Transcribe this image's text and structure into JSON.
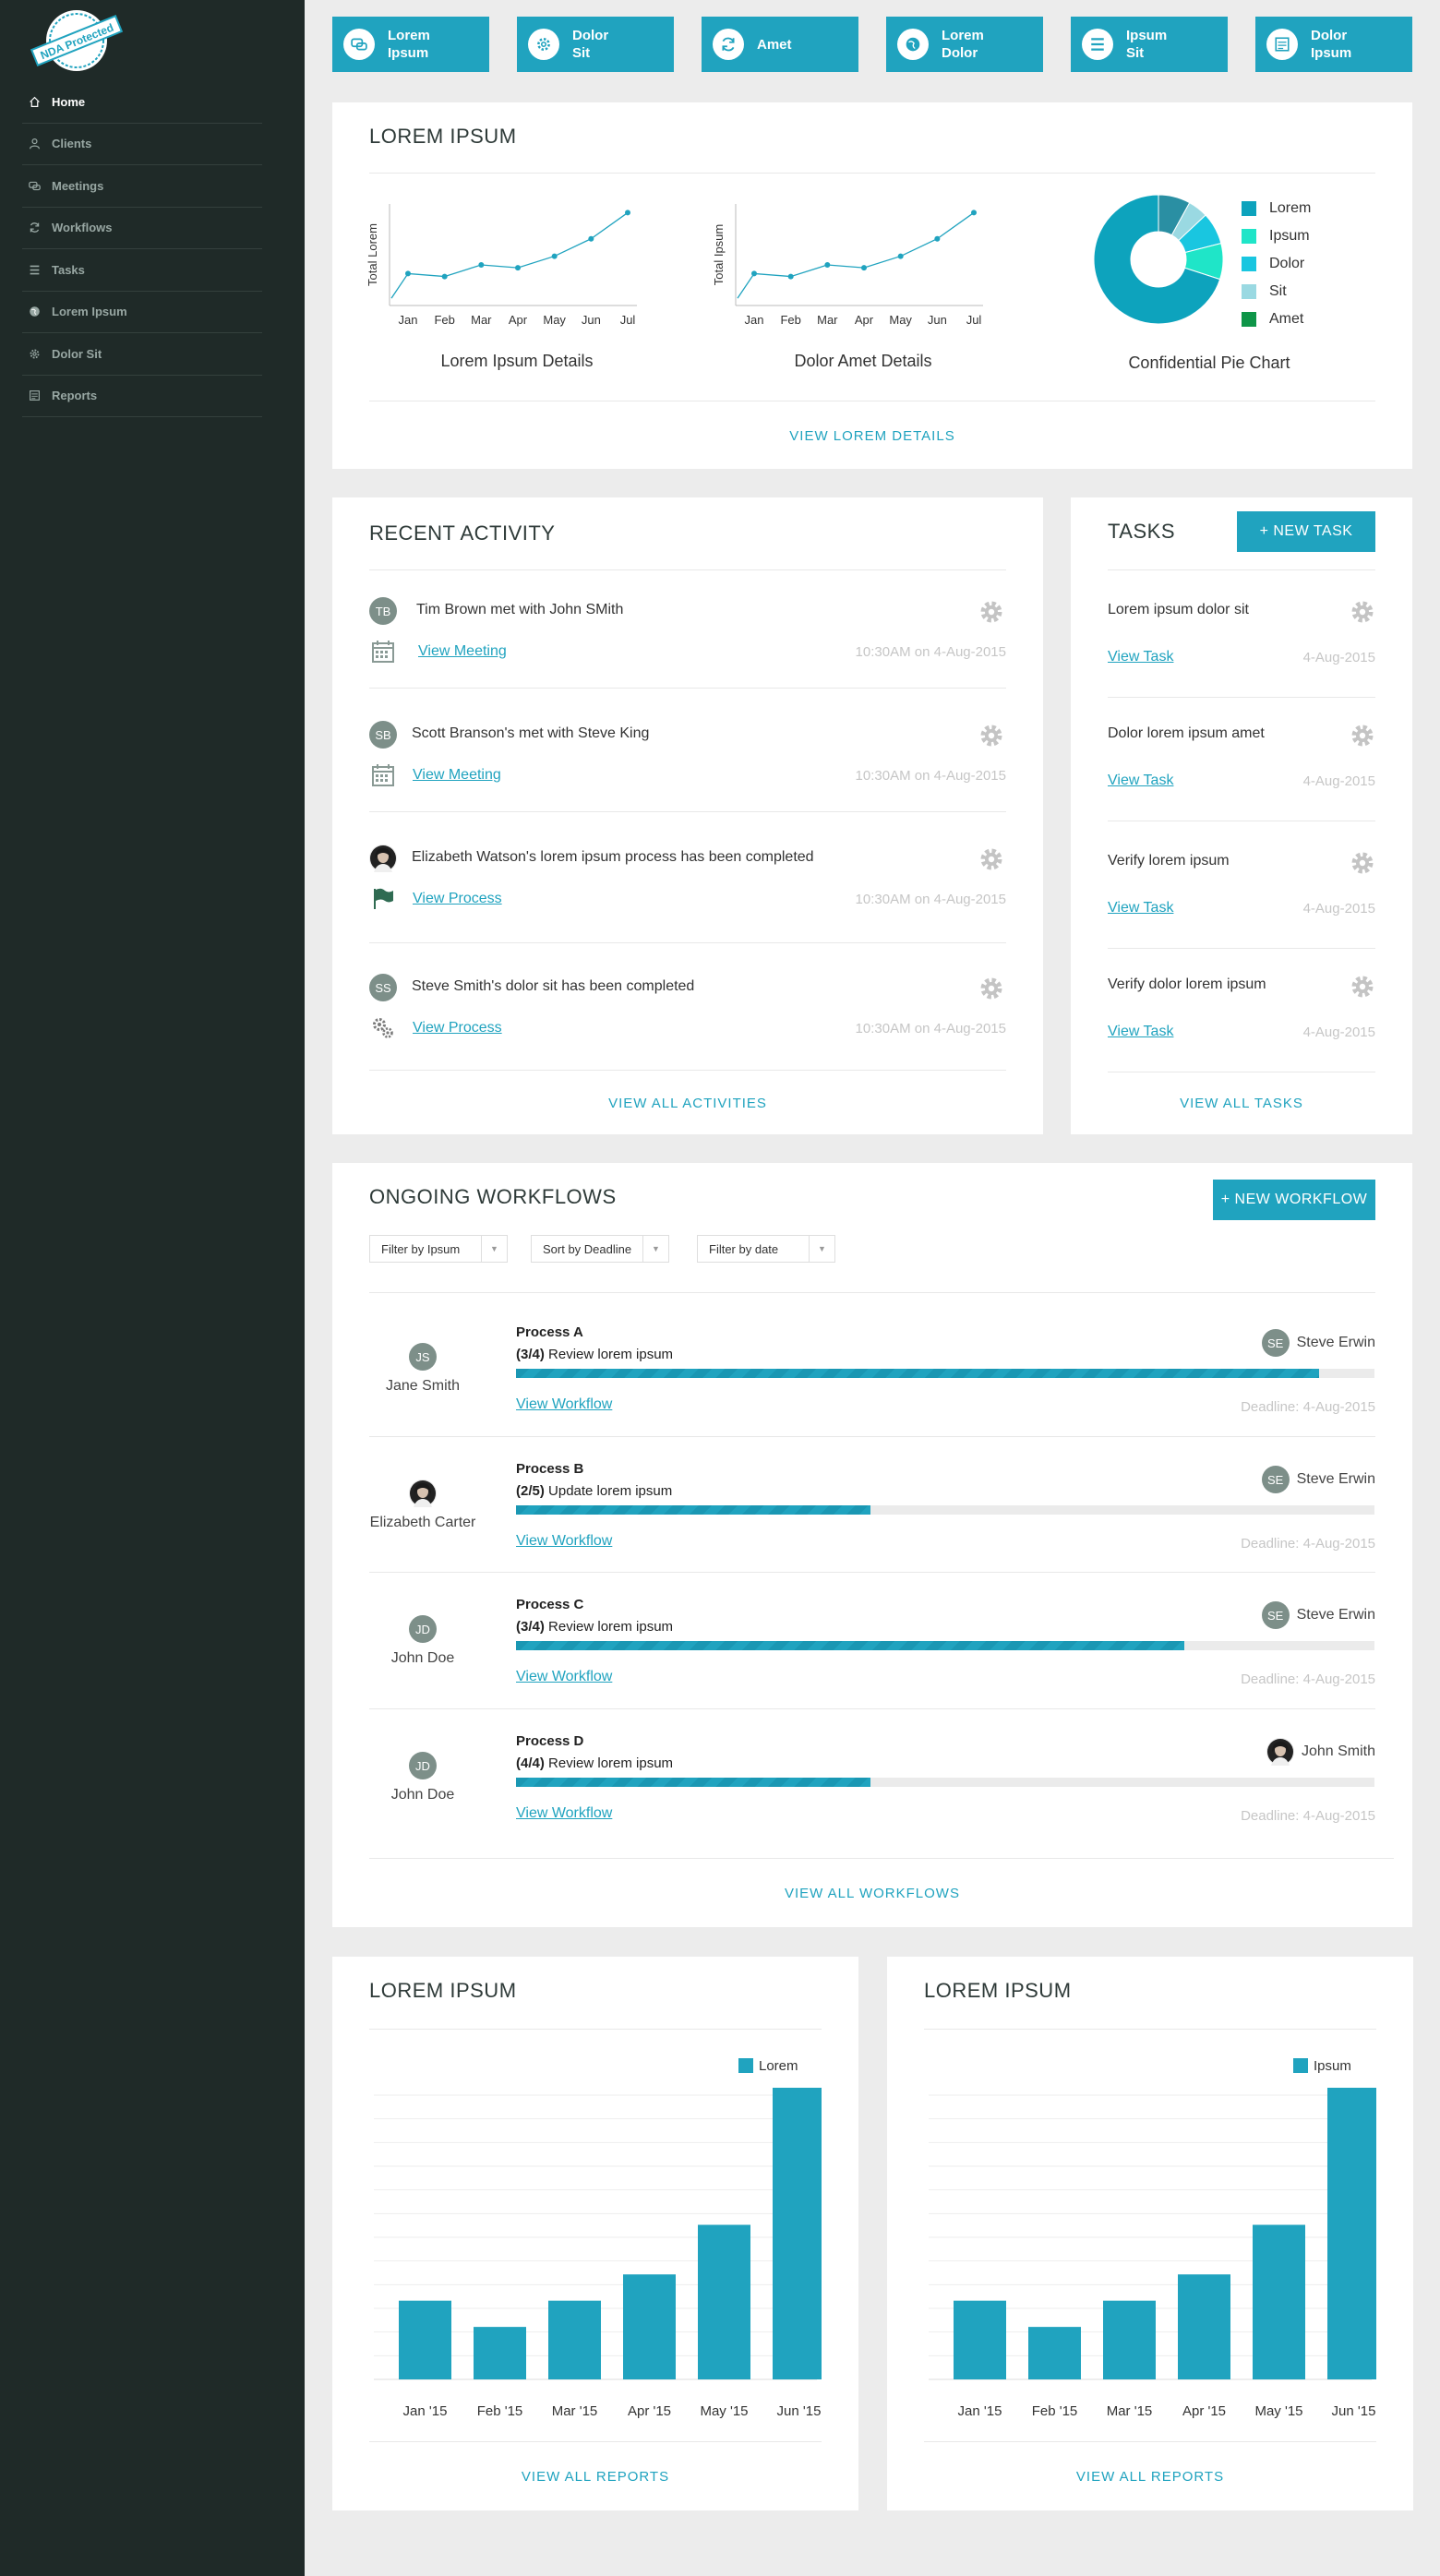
{
  "sidebar": {
    "logo_text": "NDA Protected",
    "items": [
      {
        "label": "Home",
        "icon": "home-icon",
        "active": true
      },
      {
        "label": "Clients",
        "icon": "user-icon"
      },
      {
        "label": "Meetings",
        "icon": "chat-icon"
      },
      {
        "label": "Workflows",
        "icon": "refresh-icon"
      },
      {
        "label": "Tasks",
        "icon": "list-icon"
      },
      {
        "label": "Lorem Ipsum",
        "icon": "globe-icon"
      },
      {
        "label": "Dolor Sit",
        "icon": "gear-icon"
      },
      {
        "label": "Reports",
        "icon": "report-icon"
      }
    ]
  },
  "tiles": [
    {
      "label": "Lorem\nIpsum",
      "icon": "chat-icon"
    },
    {
      "label": "Dolor\nSit",
      "icon": "gear-icon"
    },
    {
      "label": "Amet",
      "icon": "refresh-icon"
    },
    {
      "label": "Lorem\nDolor",
      "icon": "globe-icon"
    },
    {
      "label": "Ipsum\nSit",
      "icon": "list-icon"
    },
    {
      "label": "Dolor\nIpsum",
      "icon": "report-icon"
    }
  ],
  "overview": {
    "title": "LOREM IPSUM",
    "link": "VIEW LOREM DETAILS"
  },
  "chart_data": [
    {
      "type": "line",
      "title": "Lorem Ipsum Details",
      "ylabel": "Total Lorem",
      "x": [
        "Jan",
        "Feb",
        "Mar",
        "Apr",
        "May",
        "Jun",
        "Jul"
      ],
      "values": [
        22,
        20,
        28,
        26,
        34,
        46,
        64
      ],
      "extra_start": 5
    },
    {
      "type": "line",
      "title": "Dolor Amet Details",
      "ylabel": "Total Ipsum",
      "x": [
        "Jan",
        "Feb",
        "Mar",
        "Apr",
        "May",
        "Jun",
        "Jul"
      ],
      "values": [
        22,
        20,
        28,
        26,
        34,
        46,
        64
      ],
      "extra_start": 5
    },
    {
      "type": "pie",
      "title": "Confidential Pie Chart",
      "labels": [
        "Lorem",
        "Ipsum",
        "Dolor",
        "Sit",
        "Amet"
      ],
      "values": [
        70,
        10,
        10,
        5,
        5
      ],
      "colors": [
        "#0da3bd",
        "#1fe5c8",
        "#19c6e0",
        "#9ad9e2",
        "#0e9548"
      ]
    },
    {
      "type": "bar",
      "title": "LOREM IPSUM",
      "categories": [
        "Jan '15",
        "Feb '15",
        "Mar '15",
        "Apr '15",
        "May '15",
        "Jun '15"
      ],
      "series": [
        {
          "name": "Lorem",
          "values": [
            27,
            18,
            27,
            36,
            53,
            100
          ]
        }
      ],
      "ylim": [
        0,
        100
      ],
      "color": "#20a3bf"
    },
    {
      "type": "bar",
      "title": "LOREM IPSUM",
      "categories": [
        "Jan '15",
        "Feb '15",
        "Mar '15",
        "Apr '15",
        "May '15",
        "Jun '15"
      ],
      "series": [
        {
          "name": "Ipsum",
          "values": [
            27,
            18,
            27,
            36,
            53,
            100
          ]
        }
      ],
      "ylim": [
        0,
        100
      ],
      "color": "#20a3bf"
    }
  ],
  "activity": {
    "title": "RECENT ACTIVITY",
    "link": "VIEW ALL ACTIVITIES",
    "items": [
      {
        "initials": "TB",
        "text": "Tim Brown met with John SMith",
        "action": "View Meeting",
        "action_icon": "calendar-icon",
        "time": "10:30AM on 4-Aug-2015"
      },
      {
        "initials": "SB",
        "text": "Scott Branson's met with Steve King",
        "action": "View Meeting",
        "action_icon": "calendar-icon",
        "time": "10:30AM on 4-Aug-2015"
      },
      {
        "initials": "",
        "photo": true,
        "text": "Elizabeth Watson's lorem ipsum process has been completed",
        "action": "View Process",
        "action_icon": "flag-icon",
        "time": "10:30AM on 4-Aug-2015"
      },
      {
        "initials": "SS",
        "text": "Steve Smith's dolor sit has been completed",
        "action": "View Process",
        "action_icon": "gears-icon",
        "time": "10:30AM on 4-Aug-2015"
      }
    ]
  },
  "tasks": {
    "title": "TASKS",
    "new_button": "+ NEW TASK",
    "link": "VIEW ALL TASKS",
    "items": [
      {
        "text": "Lorem ipsum dolor sit",
        "action": "View Task",
        "date": "4-Aug-2015"
      },
      {
        "text": "Dolor lorem ipsum amet",
        "action": "View Task",
        "date": "4-Aug-2015"
      },
      {
        "text": "Verify lorem ipsum",
        "action": "View Task",
        "date": "4-Aug-2015"
      },
      {
        "text": "Verify dolor lorem ipsum",
        "action": "View Task",
        "date": "4-Aug-2015"
      }
    ]
  },
  "workflows": {
    "title": "ONGOING WORKFLOWS",
    "new_button": "+ NEW WORKFLOW",
    "link": "VIEW ALL WORKFLOWS",
    "filters": [
      "Filter by Ipsum",
      "Sort by Deadline",
      "Filter by date"
    ],
    "items": [
      {
        "owner_initials": "JS",
        "owner": "Jane Smith",
        "process": "Process A",
        "step": "(3/4)",
        "step_text": "Review lorem ipsum",
        "progress": 0.935,
        "assignee_initials": "SE",
        "assignee": "Steve Erwin",
        "action": "View Workflow",
        "deadline": "Deadline: 4-Aug-2015"
      },
      {
        "owner_initials": "",
        "owner_photo": true,
        "owner": "Elizabeth Carter",
        "process": "Process B",
        "step": "(2/5)",
        "step_text": "Update lorem ipsum",
        "progress": 0.413,
        "assignee_initials": "SE",
        "assignee": "Steve Erwin",
        "action": "View Workflow",
        "deadline": "Deadline: 4-Aug-2015"
      },
      {
        "owner_initials": "JD",
        "owner": "John Doe",
        "process": "Process C",
        "step": "(3/4)",
        "step_text": "Review lorem ipsum",
        "progress": 0.778,
        "assignee_initials": "SE",
        "assignee": "Steve Erwin",
        "action": "View Workflow",
        "deadline": "Deadline: 4-Aug-2015"
      },
      {
        "owner_initials": "JD",
        "owner": "John Doe",
        "process": "Process D",
        "step": "(4/4)",
        "step_text": "Review lorem ipsum",
        "progress": 0.413,
        "assignee_initials": "",
        "assignee_photo": true,
        "assignee": "John Smith",
        "action": "View Workflow",
        "deadline": "Deadline: 4-Aug-2015"
      }
    ]
  },
  "reports": [
    {
      "title": "LOREM IPSUM",
      "link": "VIEW ALL REPORTS"
    },
    {
      "title": "LOREM IPSUM",
      "link": "VIEW ALL REPORTS"
    }
  ],
  "colors": {
    "accent": "#20a3bf",
    "sidebar": "#1f2a28",
    "avatar": "#7d8f89"
  }
}
